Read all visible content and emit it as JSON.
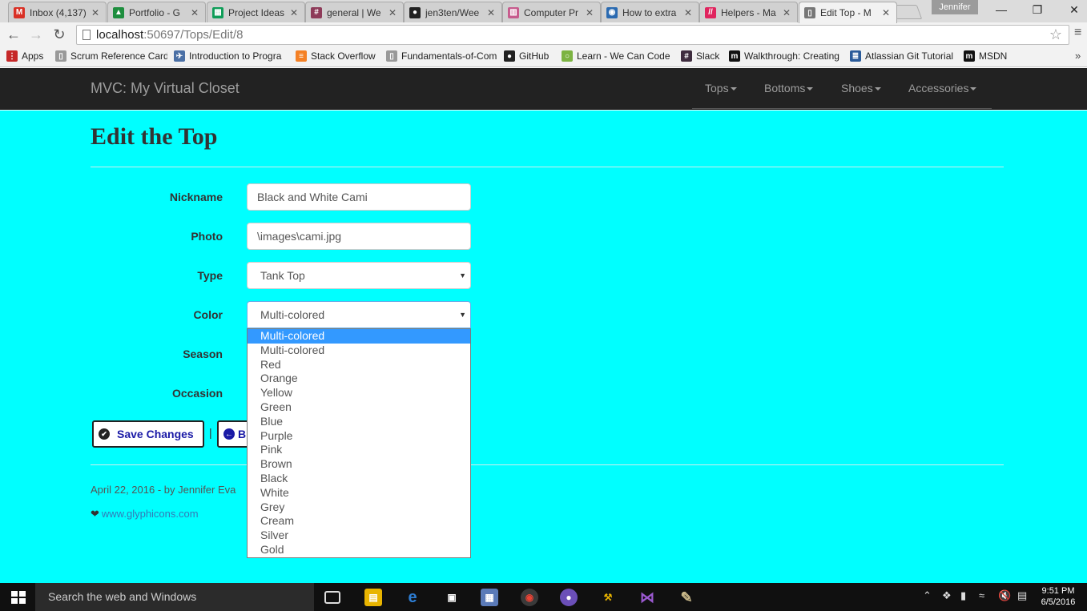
{
  "browser": {
    "tabs": [
      {
        "title": "Inbox (4,137)",
        "fav_color": "#d93025",
        "fav_char": "M"
      },
      {
        "title": "Portfolio - G",
        "fav_color": "#1e8e3e",
        "fav_char": "▲"
      },
      {
        "title": "Project Ideas",
        "fav_color": "#0f9d58",
        "fav_char": "▦"
      },
      {
        "title": "general | We",
        "fav_color": "#8e3b59",
        "fav_char": "#"
      },
      {
        "title": "jen3ten/Wee",
        "fav_color": "#222222",
        "fav_char": "●"
      },
      {
        "title": "Computer Pr",
        "fav_color": "#c75b8d",
        "fav_char": "▥"
      },
      {
        "title": "How to extra",
        "fav_color": "#2a6ab1",
        "fav_char": "◉"
      },
      {
        "title": "Helpers - Ma",
        "fav_color": "#e0245e",
        "fav_char": "//"
      },
      {
        "title": "Edit Top - M",
        "fav_color": "#777777",
        "fav_char": "▯"
      }
    ],
    "profile_name": "Jennifer",
    "url_host": "localhost",
    "url_path": ":50697/Tops/Edit/8",
    "bookmarks": [
      {
        "label": "Apps",
        "fav_color": "#c62828",
        "fav_char": "⋮"
      },
      {
        "label": "Scrum Reference Card",
        "fav_color": "#999999",
        "fav_char": "▯"
      },
      {
        "label": "Introduction to Progra",
        "fav_color": "#4a6fa5",
        "fav_char": "✈"
      },
      {
        "label": "Stack Overflow",
        "fav_color": "#f48024",
        "fav_char": "≡"
      },
      {
        "label": "Fundamentals-of-Com",
        "fav_color": "#999999",
        "fav_char": "▯"
      },
      {
        "label": "GitHub",
        "fav_color": "#222222",
        "fav_char": "●"
      },
      {
        "label": "Learn - We Can Code",
        "fav_color": "#7cb342",
        "fav_char": "○"
      },
      {
        "label": "Slack",
        "fav_color": "#3e2c3e",
        "fav_char": "#"
      },
      {
        "label": "Walkthrough: Creating",
        "fav_color": "#111111",
        "fav_char": "m"
      },
      {
        "label": "Atlassian Git Tutorial",
        "fav_color": "#2a5b9a",
        "fav_char": "≣"
      },
      {
        "label": "MSDN",
        "fav_color": "#111111",
        "fav_char": "m"
      }
    ]
  },
  "site": {
    "brand": "MVC: My Virtual Closet",
    "nav": [
      "Tops",
      "Bottoms",
      "Shoes",
      "Accessories"
    ]
  },
  "page": {
    "title": "Edit the Top",
    "fields": {
      "nickname": {
        "label": "Nickname",
        "value": "Black and White Cami"
      },
      "photo": {
        "label": "Photo",
        "value": "\\images\\cami.jpg"
      },
      "type": {
        "label": "Type",
        "value": "Tank Top"
      },
      "color": {
        "label": "Color",
        "value": "Multi-colored"
      },
      "season": {
        "label": "Season"
      },
      "occasion": {
        "label": "Occasion"
      }
    },
    "color_options": [
      "Multi-colored",
      "Multi-colored",
      "Red",
      "Orange",
      "Yellow",
      "Green",
      "Blue",
      "Purple",
      "Pink",
      "Brown",
      "Black",
      "White",
      "Grey",
      "Cream",
      "Silver",
      "Gold"
    ],
    "color_selected_index": 0,
    "save_label": "Save Changes",
    "separator": "|",
    "back_label_visible": "B",
    "footer_date": "April 22, 2016 - by Jennifer Eva",
    "footer_link": "www.glyphicons.com",
    "background_color": "#00ffff"
  },
  "taskbar": {
    "search_placeholder": "Search the web and Windows",
    "time": "9:51 PM",
    "date": "6/5/2016"
  }
}
